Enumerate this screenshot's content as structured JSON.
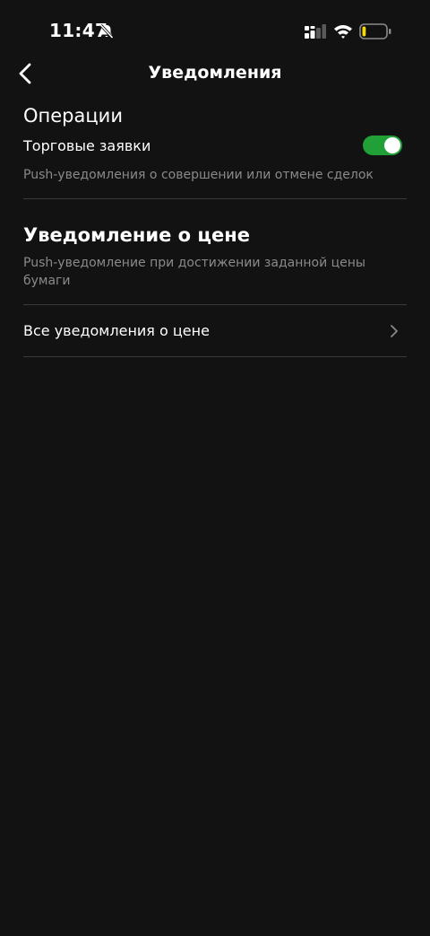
{
  "status_bar": {
    "time": "11:47",
    "icons": [
      "bell-off-icon",
      "signal-icon",
      "wifi-icon",
      "battery-icon"
    ],
    "battery_level": 0.15,
    "battery_color": "#f5d90a"
  },
  "nav": {
    "title": "Уведомления",
    "back_icon": "chevron-left-icon"
  },
  "operations": {
    "title": "Операции",
    "trade_orders": {
      "label": "Торговые заявки",
      "enabled": true,
      "description": "Push-уведомления о совершении или отмене сделок"
    }
  },
  "price_alerts": {
    "title": "Уведомление о цене",
    "description": "Push-уведомление при достижении заданной цены бумаги",
    "all_link": {
      "label": "Все уведомления о цене",
      "icon": "chevron-right-icon"
    }
  },
  "colors": {
    "background": "#121212",
    "toggle_on": "#21a038",
    "secondary_text": "#8a8a8a",
    "divider": "#3a3a3a"
  }
}
